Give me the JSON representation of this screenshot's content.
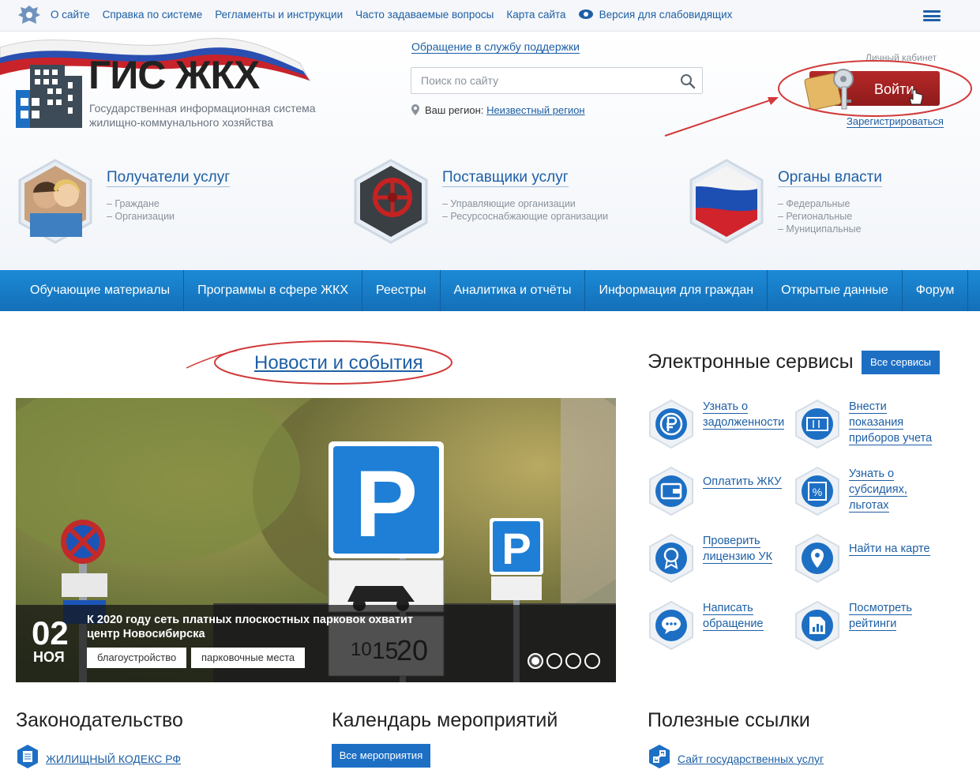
{
  "topbar": {
    "links": [
      "О сайте",
      "Справка по системе",
      "Регламенты и инструкции",
      "Часто задаваемые вопросы",
      "Карта сайта"
    ],
    "accessibility": "Версия для слабовидящих"
  },
  "logo": {
    "title": "ГИС ЖКХ",
    "subtitle": "Государственная информационная система жилищно-коммунального хозяйства"
  },
  "header": {
    "support_link": "Обращение в службу поддержки",
    "search_placeholder": "Поиск по сайту",
    "region_label": "Ваш регион:",
    "region_value": "Неизвестный регион",
    "cabinet_label": "Личный кабинет",
    "login": "Войти",
    "register": "Зарегистрироваться"
  },
  "categories": [
    {
      "title": "Получатели услуг",
      "items": [
        "– Граждане",
        "– Организации"
      ]
    },
    {
      "title": "Поставщики услуг",
      "items": [
        "– Управляющие организации",
        "– Ресурсоснабжающие организации"
      ]
    },
    {
      "title": "Органы власти",
      "items": [
        "– Федеральные",
        "– Региональные",
        "– Муниципальные"
      ]
    }
  ],
  "mainnav": [
    "Обучающие материалы",
    "Программы в сфере ЖКХ",
    "Реестры",
    "Аналитика и отчёты",
    "Информация для граждан",
    "Открытые данные",
    "Форум"
  ],
  "news": {
    "title": "Новости и события",
    "slide": {
      "day": "02",
      "month": "НОЯ",
      "text": "К 2020 году сеть платных плоскостных парковок охватит центр Новосибирска",
      "tags": [
        "благоустройство",
        "парковочные места"
      ],
      "sign_numbers": [
        "10",
        "15",
        "20"
      ]
    }
  },
  "services": {
    "title": "Электронные сервисы",
    "all_button": "Все сервисы",
    "items": [
      {
        "lines": [
          "Узнать о",
          "задолженности"
        ],
        "icon": "ruble-icon"
      },
      {
        "lines": [
          "Внести",
          "показания",
          "приборов учета"
        ],
        "icon": "meter-icon"
      },
      {
        "lines": [
          "Оплатить ЖКУ"
        ],
        "icon": "wallet-icon"
      },
      {
        "lines": [
          "Узнать о",
          "субсидиях,",
          "льготах"
        ],
        "icon": "percent-icon"
      },
      {
        "lines": [
          "Проверить",
          "лицензию УК"
        ],
        "icon": "license-icon"
      },
      {
        "lines": [
          "Найти на карте"
        ],
        "icon": "map-pin-icon"
      },
      {
        "lines": [
          "Написать",
          "обращение"
        ],
        "icon": "chat-icon"
      },
      {
        "lines": [
          "Посмотреть",
          "рейтинги"
        ],
        "icon": "rating-icon"
      }
    ]
  },
  "bottom": {
    "law_title": "Законодательство",
    "law_link": "ЖИЛИЩНЫЙ КОДЕКС РФ",
    "calendar_title": "Календарь мероприятий",
    "calendar_button": "Все мероприятия",
    "links_title": "Полезные ссылки",
    "links_item": "Сайт государственных услуг"
  },
  "colors": {
    "brand_blue": "#1d6fc4",
    "nav_blue": "#1c8ad6",
    "login_red": "#b42828",
    "annotation_red": "#d23a3a"
  }
}
